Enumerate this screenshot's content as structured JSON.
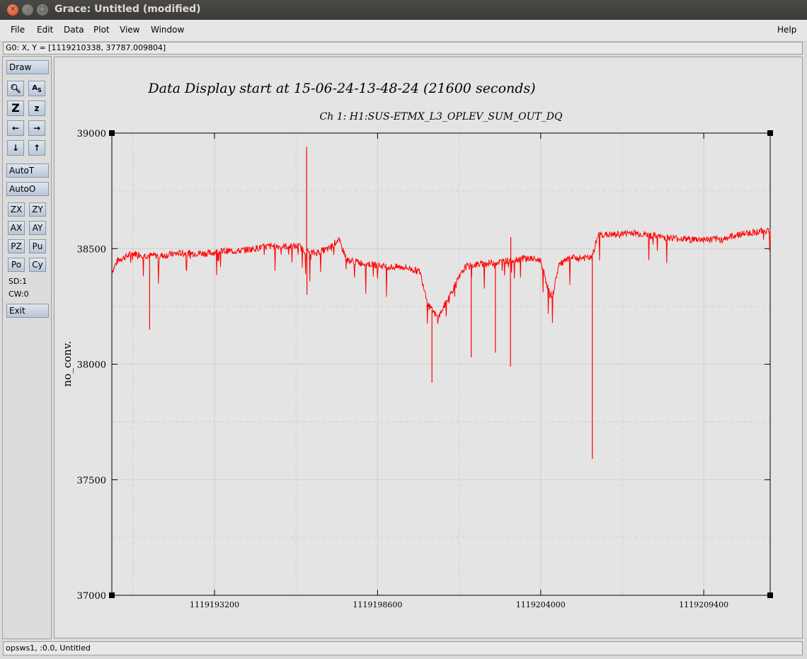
{
  "window": {
    "title": "Grace: Untitled (modified)"
  },
  "menu": {
    "left": [
      {
        "label": "File"
      },
      {
        "label": "Edit"
      },
      {
        "label": "Data"
      },
      {
        "label": "Plot"
      },
      {
        "label": "View"
      },
      {
        "label": "Window"
      }
    ],
    "help": "Help"
  },
  "locator": "G0: X, Y = [1119210338, 37787.009804]",
  "tools": {
    "draw": "Draw",
    "autot": "AutoT",
    "autoo": "AutoO",
    "exit": "Exit",
    "sd": "SD:1",
    "cw": "CW:0",
    "small": [
      "ZX",
      "ZY",
      "AX",
      "AY",
      "PZ",
      "Pu",
      "Po",
      "Cy"
    ]
  },
  "status": "opsws1, :0.0, Untitled",
  "chart_data": {
    "type": "line",
    "title": "Data Display start at 15-06-24-13-48-24 (21600 seconds)",
    "subtitle": "Ch 1: H1:SUS-ETMX_L3_OPLEV_SUM_OUT_DQ",
    "xlabel": "",
    "ylabel": "no_conv.",
    "xlim": [
      1119189800,
      1119211600
    ],
    "ylim": [
      37000,
      39000
    ],
    "xticks": [
      1119193200,
      1119198600,
      1119204000,
      1119209400
    ],
    "yticks": [
      37000,
      37500,
      38000,
      38500,
      39000
    ],
    "grid": true,
    "color": "#ff0000",
    "series": [
      {
        "x": [
          1119189800,
          1119190000,
          1119190500,
          1119191000,
          1119191300,
          1119191500,
          1119192000,
          1119193000,
          1119193500,
          1119194000,
          1119195000,
          1119196000,
          1119196200,
          1119196500,
          1119197000,
          1119197300,
          1119197600,
          1119198000,
          1119198500,
          1119199000,
          1119199500,
          1119200000,
          1119200300,
          1119200600,
          1119200800,
          1119201200,
          1119201500,
          1119201800,
          1119202500,
          1119203000,
          1119203500,
          1119204000,
          1119204300,
          1119204400,
          1119204600,
          1119205000,
          1119205700,
          1119205900,
          1119206500,
          1119207000,
          1119208000,
          1119209000,
          1119210000,
          1119210500,
          1119211000,
          1119211600
        ],
        "y": [
          38400,
          38450,
          38480,
          38470,
          38470,
          38470,
          38480,
          38480,
          38490,
          38490,
          38510,
          38510,
          38490,
          38480,
          38500,
          38540,
          38450,
          38440,
          38430,
          38420,
          38420,
          38400,
          38250,
          38200,
          38250,
          38350,
          38420,
          38430,
          38440,
          38450,
          38460,
          38450,
          38300,
          38300,
          38430,
          38460,
          38460,
          38560,
          38560,
          38570,
          38550,
          38540,
          38540,
          38560,
          38570,
          38580
        ]
      }
    ],
    "spikes": [
      {
        "x": 1119191050,
        "y": 38150
      },
      {
        "x": 1119196250,
        "y": 38940
      },
      {
        "x": 1119196260,
        "y": 38300
      },
      {
        "x": 1119201700,
        "y": 38030
      },
      {
        "x": 1119200400,
        "y": 37920
      },
      {
        "x": 1119202500,
        "y": 38050
      },
      {
        "x": 1119203000,
        "y": 37990
      },
      {
        "x": 1119203010,
        "y": 38550
      },
      {
        "x": 1119205710,
        "y": 37590
      }
    ]
  }
}
